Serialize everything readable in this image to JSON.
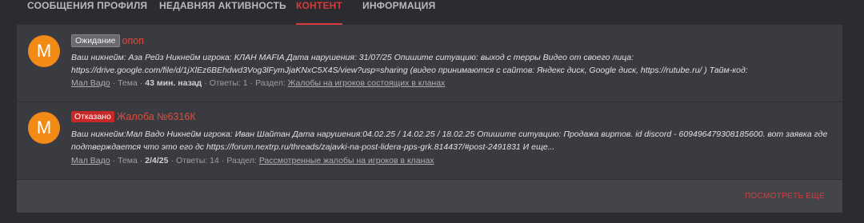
{
  "tabs": [
    {
      "label": "СООБЩЕНИЯ ПРОФИЛЯ"
    },
    {
      "label": "НЕДАВНЯЯ АКТИВНОСТЬ"
    },
    {
      "label": "КОНТЕНТ"
    },
    {
      "label": "ИНФОРМАЦИЯ"
    }
  ],
  "active_tab": "КОНТЕНТ",
  "items": [
    {
      "avatar_letter": "M",
      "badge": "Ожидание",
      "title": "опоп",
      "snippet": "Ваш никнейм: Аза Рейз Никнейм игрока: КЛАН MAFIA Дата нарушения: 31/07/25 Опишите ситуацию: выход с терры Видео от своего лица: https://drive.google.com/file/d/1jXlEz6BEhdwd3Vog3lFymJjaKNxC5X4S/view?usp=sharing (видео принимаются с сайтов: Яндекс диск, Google диск, https://rutube.ru/ ) Тайм-код:",
      "author": "Мал Вадо",
      "type": "Тема",
      "time": "43 мин. назад",
      "replies": "Ответы: 1",
      "section_label": "Раздел:",
      "section": "Жалобы на игроков состоящих в кланах"
    },
    {
      "avatar_letter": "M",
      "badge": "Отказано",
      "title": "Жалоба №6316К",
      "snippet": "Ваш никнейм:Мал Вадо Никнейм игрока: Иван Шайтан Дата нарушения:04.02.25 / 14.02.25 / 18.02.25 Опишите ситуацию: Продажа виртов. id discord - 609496479308185600. вот заявка где подтверждается что это его дс https://forum.nextrp.ru/threads/zajavki-na-post-lidera-pps-grk.814437/#post-2491831 И еще...",
      "author": "Мал Вадо",
      "type": "Тема",
      "time": "2/4/25",
      "replies": "Ответы: 14",
      "section_label": "Раздел:",
      "section": "Рассмотренные жалобы на игроков в кланах"
    }
  ],
  "footer": {
    "more_label": "ПОСМОТРЕТЬ ЕЩЕ"
  },
  "colors": {
    "accent": "#d63a3a",
    "avatar": "#f28b16",
    "panel": "#3a3b40",
    "background": "#2b2c30"
  }
}
